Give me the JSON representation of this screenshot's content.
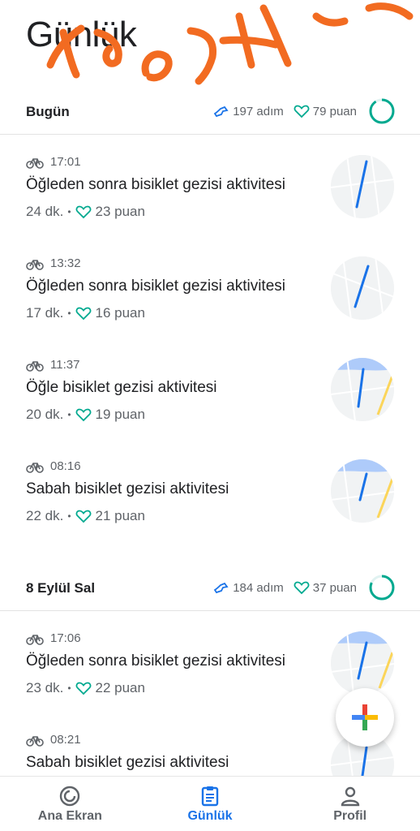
{
  "page": {
    "title": "Günlük"
  },
  "days": [
    {
      "label": "Bugün",
      "steps": "197 adım",
      "points": "79 puan",
      "activities": [
        {
          "time": "17:01",
          "title": "Öğleden sonra bisiklet gezisi aktivitesi",
          "duration": "24 dk.",
          "points": "23 puan"
        },
        {
          "time": "13:32",
          "title": "Öğleden sonra bisiklet gezisi aktivitesi",
          "duration": "17 dk.",
          "points": "16 puan"
        },
        {
          "time": "11:37",
          "title": "Öğle bisiklet gezisi aktivitesi",
          "duration": "20 dk.",
          "points": "19 puan"
        },
        {
          "time": "08:16",
          "title": "Sabah bisiklet gezisi aktivitesi",
          "duration": "22 dk.",
          "points": "21 puan"
        }
      ]
    },
    {
      "label": "8 Eylül Sal",
      "steps": "184 adım",
      "points": "37 puan",
      "activities": [
        {
          "time": "17:06",
          "title": "Öğleden sonra bisiklet gezisi aktivitesi",
          "duration": "23 dk.",
          "points": "22 puan"
        },
        {
          "time": "08:21",
          "title": "Sabah bisiklet gezisi aktivitesi",
          "duration": "",
          "points": ""
        }
      ]
    }
  ],
  "bottom_nav": {
    "home_label": "Ana Ekran",
    "journal_label": "Günlük",
    "profile_label": "Profil"
  },
  "colors": {
    "accent_blue": "#1a73e8",
    "heart_teal": "#00a98f",
    "annotation_orange": "#f26b21"
  },
  "icons": [
    "bike-icon",
    "steps-icon",
    "heart-points-icon",
    "goal-ring-icon",
    "map-thumbnail",
    "add-icon",
    "home-icon",
    "journal-icon",
    "profile-icon"
  ]
}
